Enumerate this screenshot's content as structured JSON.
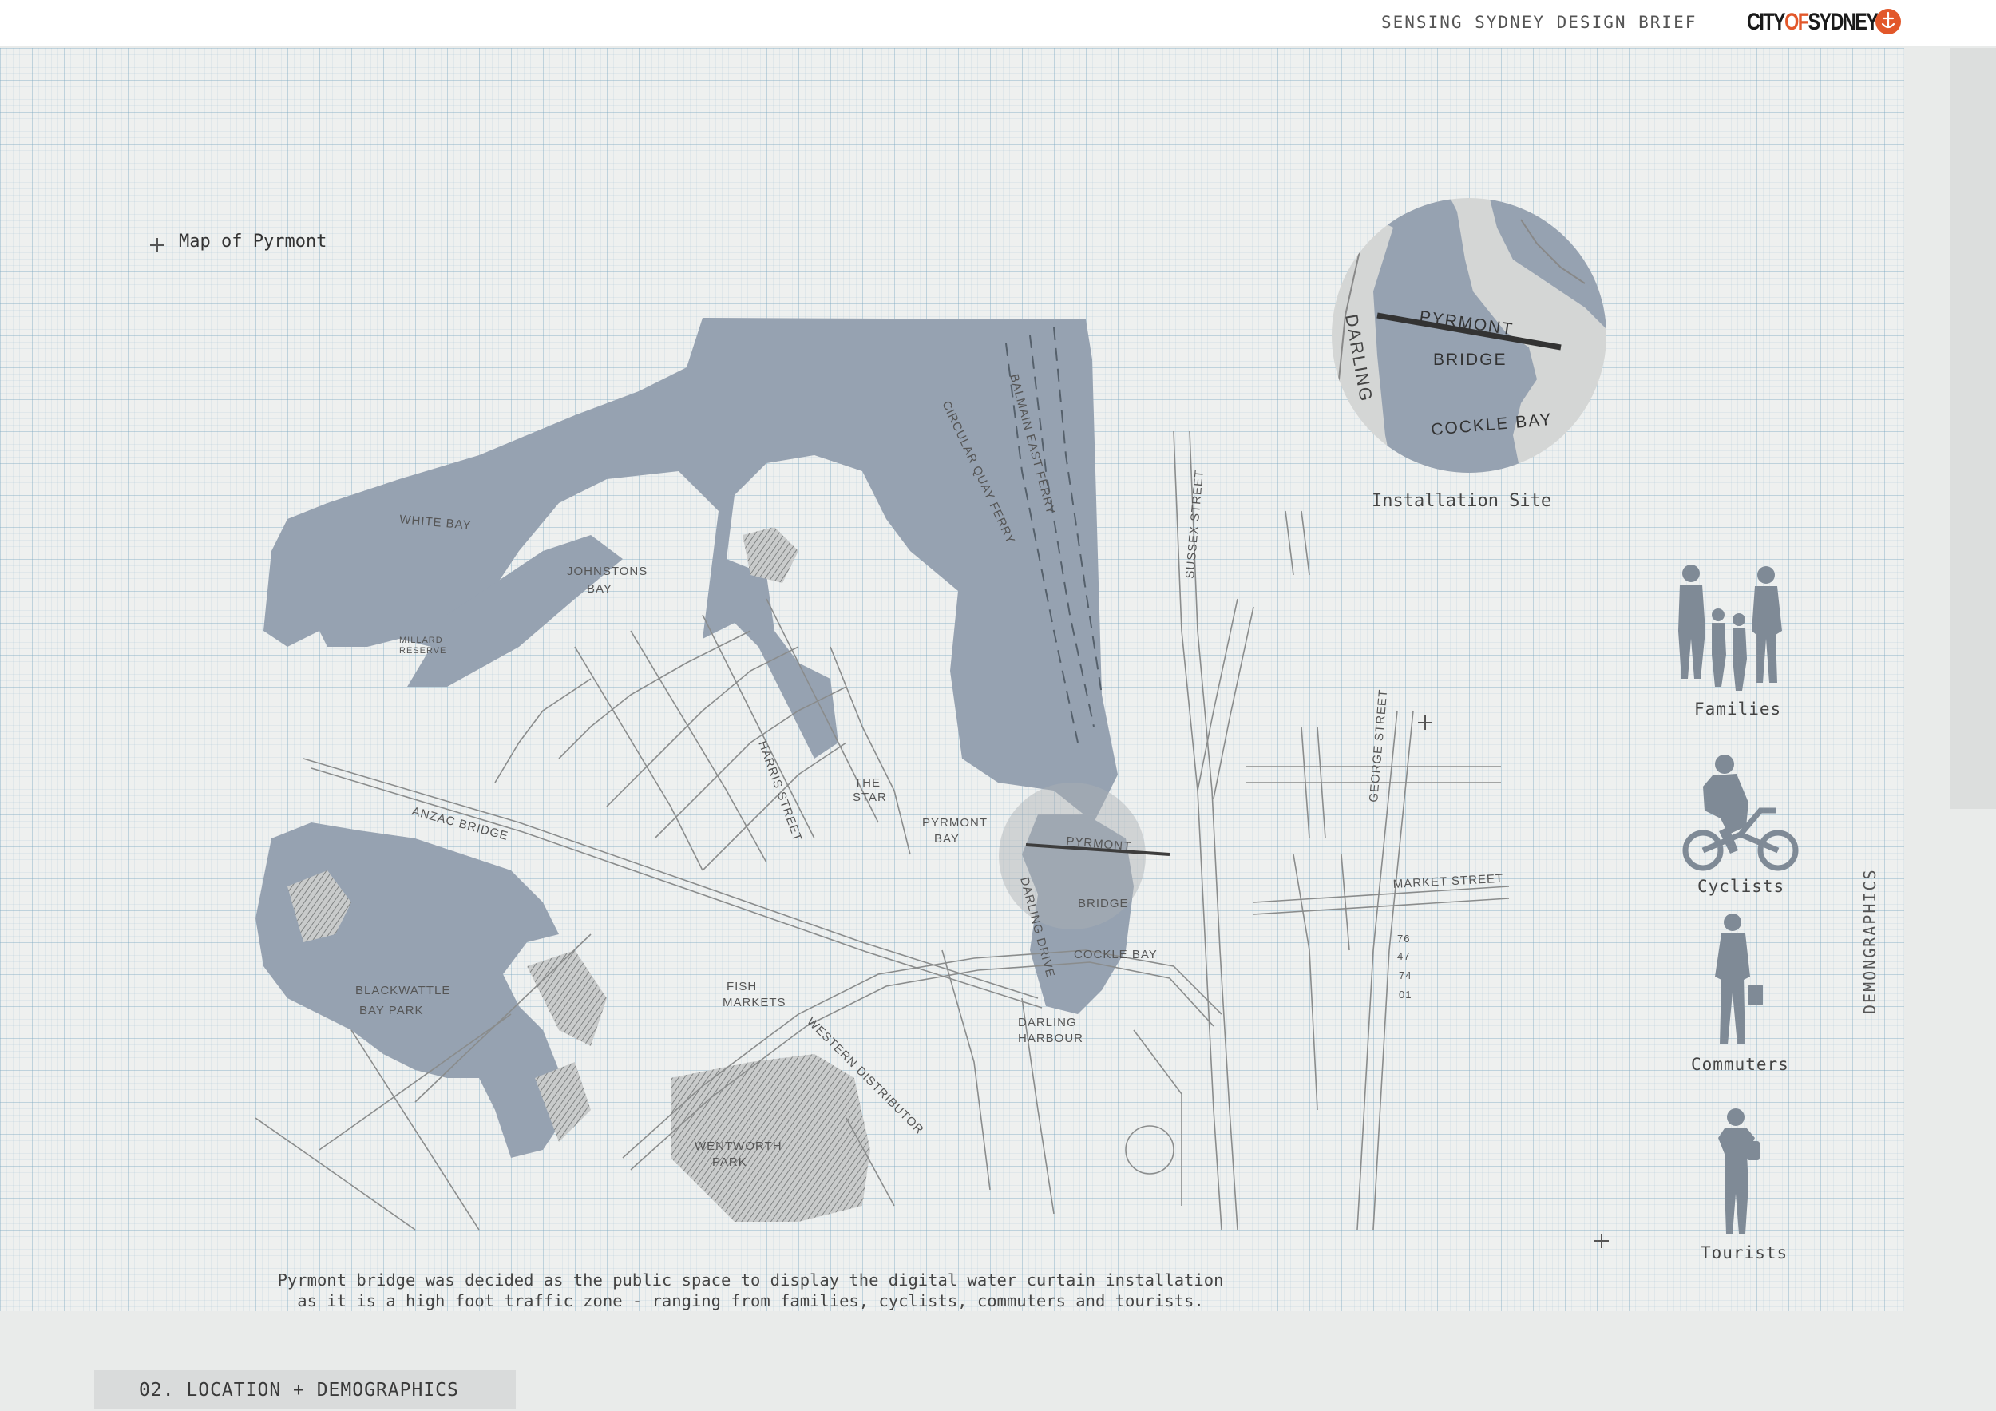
{
  "header": {
    "doc_title": "SENSING SYDNEY DESIGN BRIEF",
    "logo": {
      "text_city": "CITY",
      "text_of": "OF",
      "text_sydney": "SYDNEY",
      "icon": "city-of-sydney-emblem",
      "accent": "#e2572a"
    }
  },
  "map": {
    "title": "Map of Pyrmont",
    "water_color": "#96a2b1",
    "labels": {
      "white_bay": "WHITE BAY",
      "johnstons_bay_1": "JOHNSTONS",
      "johnstons_bay_2": "BAY",
      "millard_1": "MILLARD",
      "millard_2": "RESERVE",
      "anzac": "ANZAC BRIDGE",
      "blackwattle_1": "BLACKWATTLE",
      "blackwattle_2": "BAY PARK",
      "fish_1": "FISH",
      "fish_2": "MARKETS",
      "wentworth_1": "WENTWORTH",
      "wentworth_2": "PARK",
      "western": "WESTERN DISTRIBUTOR",
      "harris": "HARRIS STREET",
      "star_1": "THE",
      "star_2": "STAR",
      "pyrmont_bay_1": "PYRMONT",
      "pyrmont_bay_2": "BAY",
      "circular": "CIRCULAR QUAY FERRY",
      "balmain": "BALMAIN EAST FERRY",
      "sussex": "SUSSEX STREET",
      "george": "GEORGE STREET",
      "market": "MARKET STREET",
      "darling_drive": "DARLING DRIVE",
      "darling_harbour_1": "DARLING",
      "darling_harbour_2": "HARBOUR",
      "pyrmont_bridge_1": "PYRMONT",
      "pyrmont_bridge_2": "BRIDGE",
      "cockle_bay": "COCKLE BAY",
      "bus_numbers": [
        "76",
        "47",
        "74",
        "01"
      ]
    }
  },
  "inset": {
    "caption": "Installation Site",
    "labels": {
      "darling": "DARLING",
      "pyrmont": "PYRMONT",
      "bridge": "BRIDGE",
      "cockle_bay": "COCKLE BAY"
    }
  },
  "demographics": {
    "heading": "DEMONGRAPHICS",
    "groups": [
      {
        "label": "Families",
        "icon": "family-silhouette-icon"
      },
      {
        "label": "Cyclists",
        "icon": "cyclist-silhouette-icon"
      },
      {
        "label": "Commuters",
        "icon": "commuter-silhouette-icon"
      },
      {
        "label": "Tourists",
        "icon": "tourist-silhouette-icon"
      }
    ]
  },
  "caption": {
    "line1": "Pyrmont bridge was decided as the public space to display the digital water curtain installation",
    "line2": "as it is a high foot traffic zone - ranging from families, cyclists, commuters and tourists."
  },
  "footer": {
    "section": "02. LOCATION + DEMOGRAPHICS"
  }
}
